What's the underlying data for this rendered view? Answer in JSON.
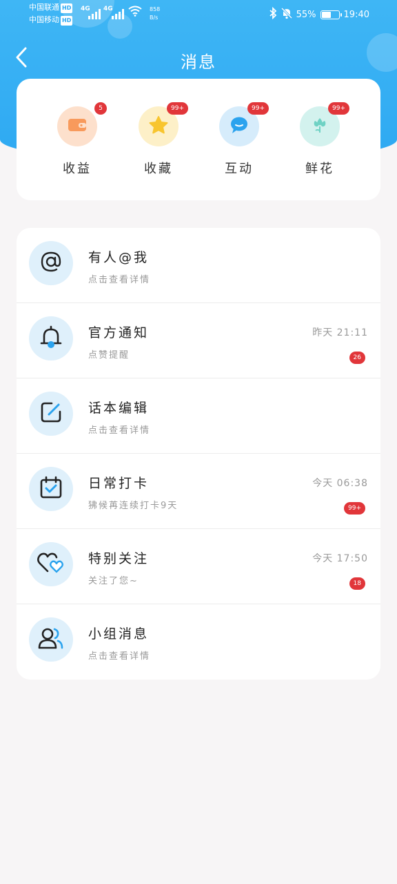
{
  "status_bar": {
    "carrier1": "中国联通",
    "carrier2": "中国移动",
    "hd": "HD",
    "net1": "4G",
    "net2": "4G",
    "speed_value": "858",
    "speed_unit": "B/s",
    "battery": "55%",
    "time": "19:40"
  },
  "header": {
    "title": "消息"
  },
  "categories": [
    {
      "label": "收益",
      "badge": "5",
      "icon": "wallet-icon"
    },
    {
      "label": "收藏",
      "badge": "99+",
      "icon": "star-icon"
    },
    {
      "label": "互动",
      "badge": "99+",
      "icon": "chat-bubble-icon"
    },
    {
      "label": "鲜花",
      "badge": "99+",
      "icon": "flower-icon"
    }
  ],
  "messages": [
    {
      "title": "有人@我",
      "subtitle": "点击查看详情",
      "time": "",
      "badge": "",
      "icon": "at-icon"
    },
    {
      "title": "官方通知",
      "subtitle": "点赞提醒",
      "time": "昨天 21:11",
      "badge": "26",
      "icon": "bell-icon"
    },
    {
      "title": "话本编辑",
      "subtitle": "点击查看详情",
      "time": "",
      "badge": "",
      "icon": "edit-icon"
    },
    {
      "title": "日常打卡",
      "subtitle": "狒候苒连续打卡9天",
      "time": "今天 06:38",
      "badge": "99+",
      "icon": "calendar-check-icon"
    },
    {
      "title": "特别关注",
      "subtitle": "关注了您~",
      "time": "今天 17:50",
      "badge": "18",
      "icon": "hearts-icon"
    },
    {
      "title": "小组消息",
      "subtitle": "点击查看详情",
      "time": "",
      "badge": "",
      "icon": "group-icon"
    }
  ],
  "colors": {
    "header": "#2ea9f2",
    "badge": "#e1363a",
    "icon_bg": "#dff0fb"
  }
}
